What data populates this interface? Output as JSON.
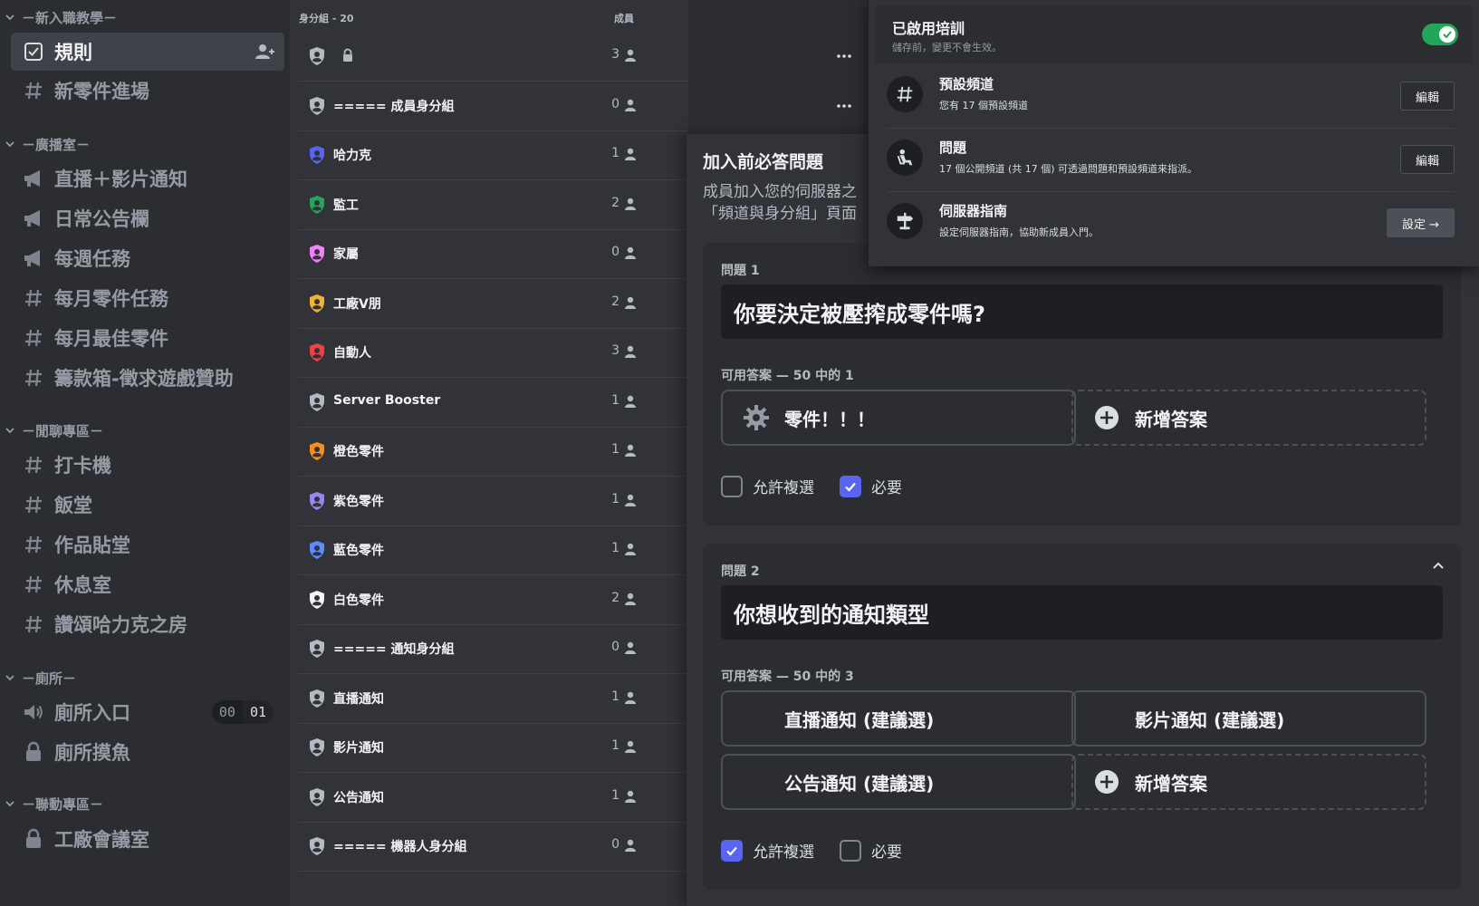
{
  "sidebar": {
    "categories": [
      {
        "label": "－新入職教學－"
      },
      {
        "label": "－廣播室－"
      },
      {
        "label": "－閒聊專區－"
      },
      {
        "label": "－廁所－"
      },
      {
        "label": "－聯動專區－"
      }
    ],
    "channels": [
      {
        "name": "規則",
        "icon": "rules-icon"
      },
      {
        "name": "新零件進場",
        "icon": "hashtag-icon"
      },
      {
        "name": "直播＋影片通知",
        "icon": "megaphone-icon"
      },
      {
        "name": "日常公告欄",
        "icon": "megaphone-icon"
      },
      {
        "name": "每週任務",
        "icon": "megaphone-icon"
      },
      {
        "name": "每月零件任務",
        "icon": "hashtag-icon"
      },
      {
        "name": "每月最佳零件",
        "icon": "hashtag-icon"
      },
      {
        "name": "籌款箱-徵求遊戲贊助",
        "icon": "hashtag-icon"
      },
      {
        "name": "打卡機",
        "icon": "hashtag-icon"
      },
      {
        "name": "飯堂",
        "icon": "hashtag-icon"
      },
      {
        "name": "作品貼堂",
        "icon": "hashtag-icon"
      },
      {
        "name": "休息室",
        "icon": "hashtag-icon"
      },
      {
        "name": "讚頌哈力克之房",
        "icon": "hashtag-icon"
      },
      {
        "name": "廁所入口",
        "icon": "speaker-icon"
      },
      {
        "name": "廁所摸魚",
        "icon": "locked-channel-icon"
      },
      {
        "name": "工廠會議室",
        "icon": "locked-channel-icon"
      }
    ],
    "voice_counter": {
      "current": "00",
      "limit": "01"
    }
  },
  "roles": {
    "header_roles": "身分組 - 20",
    "header_members": "成員",
    "items": [
      {
        "name": "",
        "count": "3",
        "color": "#b5bac1"
      },
      {
        "name": "===== 成員身分組",
        "count": "0",
        "color": "#b5bac1"
      },
      {
        "name": "哈力克",
        "count": "1",
        "color": "#5865f2"
      },
      {
        "name": "監工",
        "count": "2",
        "color": "#23a55a"
      },
      {
        "name": "家屬",
        "count": "0",
        "color": "#f47fff"
      },
      {
        "name": "工廠V朋",
        "count": "2",
        "color": "#f0b232"
      },
      {
        "name": "自動人",
        "count": "3",
        "color": "#f23f42"
      },
      {
        "name": "Server Booster",
        "count": "1",
        "color": "#b5bac1"
      },
      {
        "name": "橙色零件",
        "count": "1",
        "color": "#f78f1e"
      },
      {
        "name": "紫色零件",
        "count": "1",
        "color": "#9b84ee"
      },
      {
        "name": "藍色零件",
        "count": "1",
        "color": "#5b8cff"
      },
      {
        "name": "白色零件",
        "count": "2",
        "color": "#f2f3f5"
      },
      {
        "name": "===== 通知身分組",
        "count": "0",
        "color": "#b5bac1"
      },
      {
        "name": "直播通知",
        "count": "1",
        "color": "#b5bac1"
      },
      {
        "name": "影片通知",
        "count": "1",
        "color": "#b5bac1"
      },
      {
        "name": "公告通知",
        "count": "1",
        "color": "#b5bac1"
      },
      {
        "name": "===== 機器人身分組",
        "count": "0",
        "color": "#b5bac1"
      }
    ]
  },
  "questions": {
    "title": "加入前必答問題",
    "desc_line1": "成員加入您的伺服器之",
    "desc_line2": "「頻道與身分組」頁面",
    "q1": {
      "label": "問題 1",
      "text": "你要決定被壓搾成零件嗎?",
      "answers_label": "可用答案 — 50 中的 1",
      "answers": [
        "零件！！！"
      ],
      "add_answer": "新增答案",
      "allow_multiple": "允許複選",
      "required": "必要"
    },
    "q2": {
      "label": "問題 2",
      "text": "你想收到的通知類型",
      "answers_label": "可用答案 — 50 中的 3",
      "answers": [
        "直播通知 (建議選)",
        "影片通知 (建議選)",
        "公告通知 (建議選)"
      ],
      "add_answer": "新增答案",
      "allow_multiple": "允許複選",
      "required": "必要"
    }
  },
  "onboarding": {
    "title": "已啟用培訓",
    "subtitle": "儲存前，變更不會生效。",
    "rows": [
      {
        "name": "預設頻道",
        "desc": "您有 17 個預設頻道",
        "button": "編輯"
      },
      {
        "name": "問題",
        "desc": "17 個公開頻道 (共 17 個) 可透過問題和預設頻道來指派。",
        "button": "編輯"
      },
      {
        "name": "伺服器指南",
        "desc": "設定伺服器指南，協助新成員入門。",
        "button": "設定 →"
      }
    ]
  },
  "colors": {
    "accent": "#5865f2",
    "toggle_on": "#23a55a"
  }
}
